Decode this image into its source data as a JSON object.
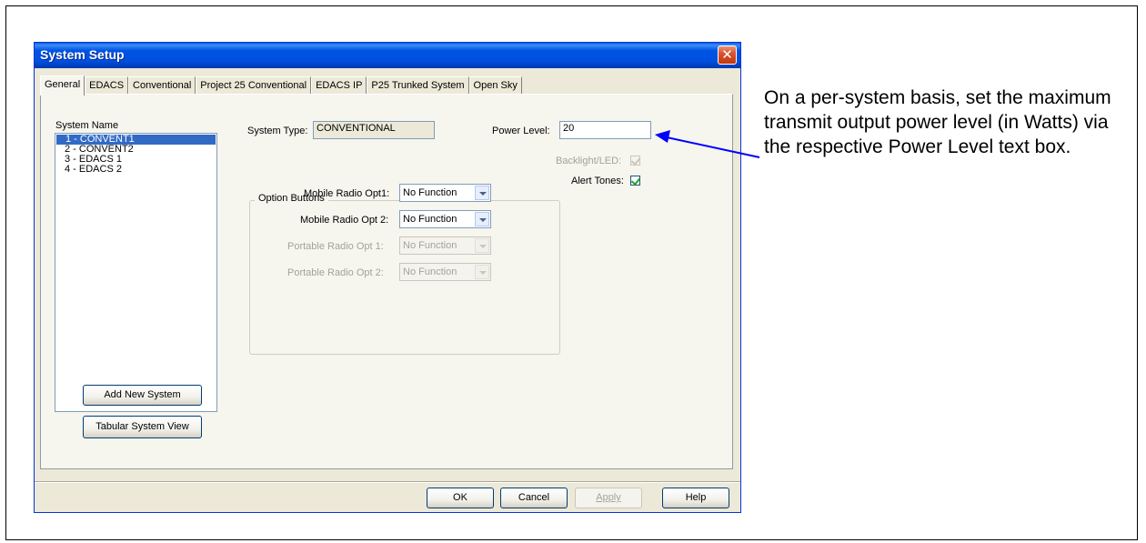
{
  "window": {
    "title": "System Setup"
  },
  "tabs": [
    {
      "label": "General",
      "active": true
    },
    {
      "label": "EDACS",
      "active": false
    },
    {
      "label": "Conventional",
      "active": false
    },
    {
      "label": "Project 25 Conventional",
      "active": false
    },
    {
      "label": "EDACS IP",
      "active": false
    },
    {
      "label": "P25 Trunked System",
      "active": false
    },
    {
      "label": "Open Sky",
      "active": false
    }
  ],
  "system_list": {
    "header": "System Name",
    "items": [
      {
        "label": "1 - CONVENT1",
        "selected": true
      },
      {
        "label": "2 - CONVENT2",
        "selected": false
      },
      {
        "label": "3 - EDACS 1",
        "selected": false
      },
      {
        "label": "4 - EDACS 2",
        "selected": false
      }
    ]
  },
  "system_type": {
    "label": "System Type:",
    "value": "CONVENTIONAL"
  },
  "power_level": {
    "label": "Power Level:",
    "value": "20"
  },
  "backlight": {
    "label": "Backlight/LED:",
    "checked": true,
    "enabled": false
  },
  "alert_tones": {
    "label": "Alert Tones:",
    "checked": true,
    "enabled": true
  },
  "option_buttons": {
    "group_label": "Option Buttons",
    "rows": [
      {
        "label": "Mobile Radio Opt1:",
        "value": "No Function",
        "enabled": true
      },
      {
        "label": "Mobile Radio Opt 2:",
        "value": "No Function",
        "enabled": true
      },
      {
        "label": "Portable Radio Opt 1:",
        "value": "No Function",
        "enabled": false
      },
      {
        "label": "Portable Radio Opt 2:",
        "value": "No Function",
        "enabled": false
      }
    ]
  },
  "buttons": {
    "add_new_system": "Add New System",
    "tabular_view": "Tabular System View",
    "ok": "OK",
    "cancel": "Cancel",
    "apply": "Apply",
    "help": "Help"
  },
  "annotation": {
    "text": "On a per-system basis, set the maximum transmit output power level (in Watts) via the respective Power Level text box."
  },
  "colors": {
    "titlebar": "#0054E3",
    "selection": "#316AC5",
    "arrow": "#0000FF",
    "window_bg": "#ECE9D8"
  },
  "icons": {
    "close": "close-icon",
    "dropdown": "chevron-down-icon",
    "check": "checkmark-icon"
  }
}
